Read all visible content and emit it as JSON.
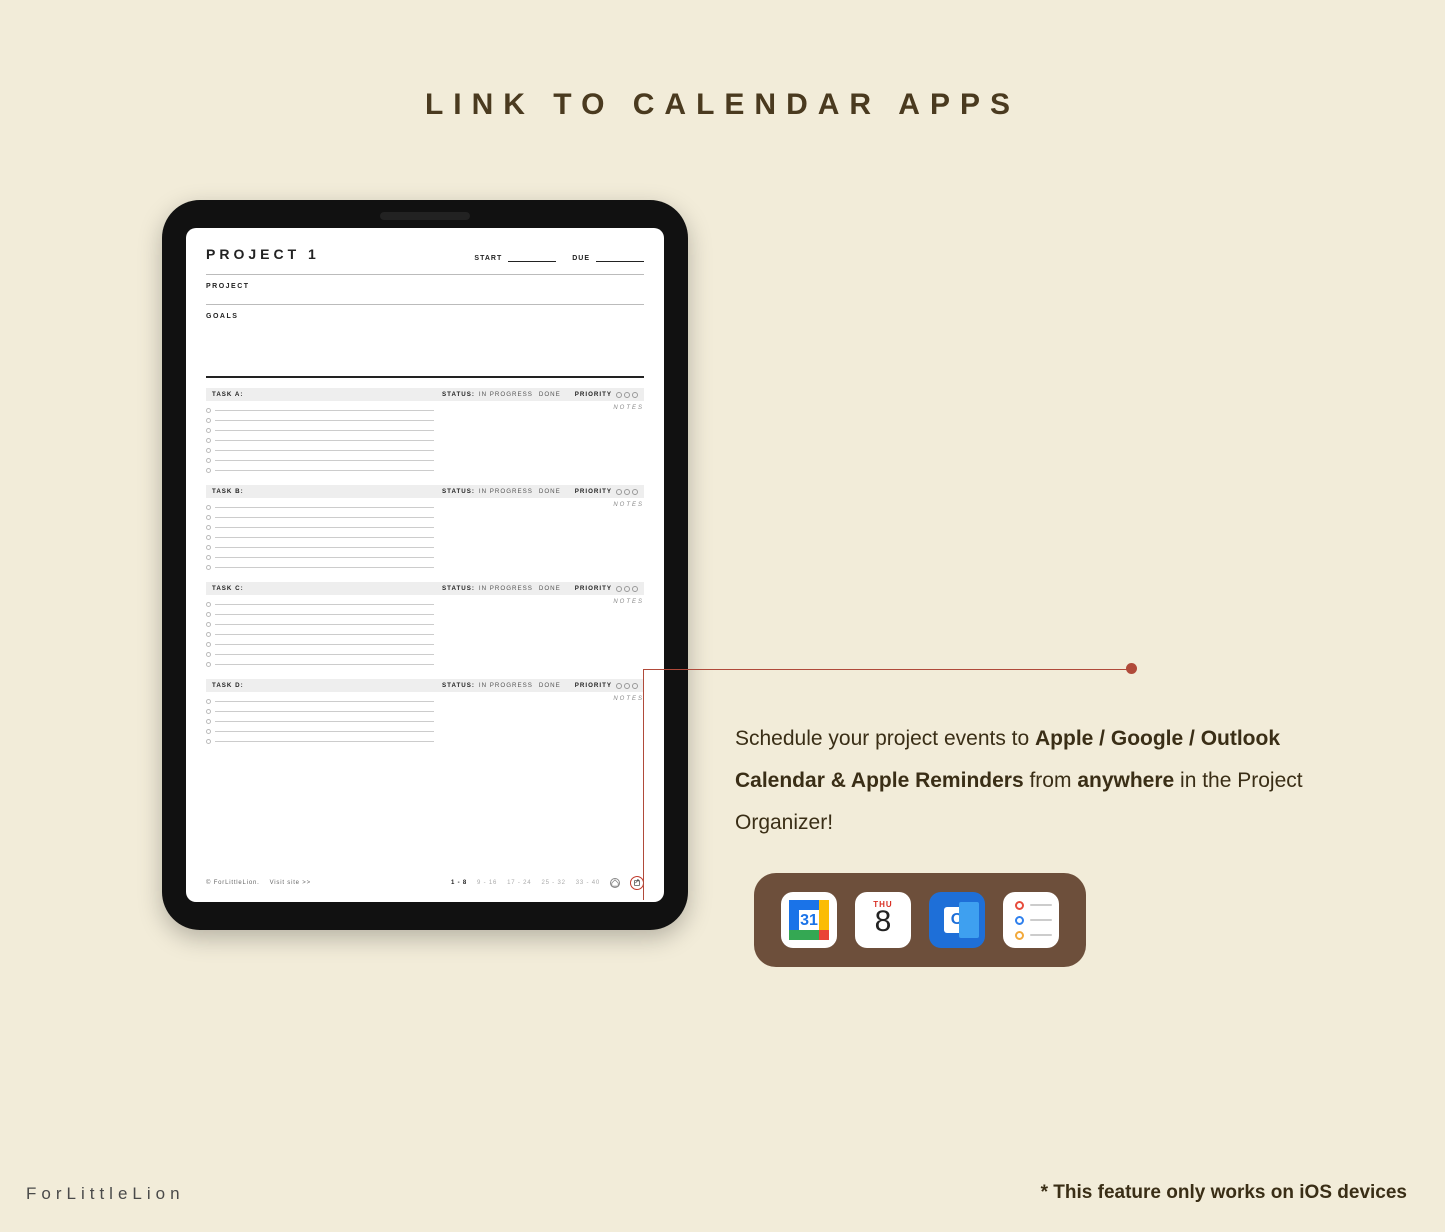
{
  "title": "LINK TO CALENDAR APPS",
  "planner": {
    "title": "PROJECT 1",
    "start_label": "START",
    "due_label": "DUE",
    "project_label": "PROJECT",
    "goals_label": "GOALS",
    "status_label": "STATUS:",
    "status_in_progress": "IN PROGRESS",
    "status_done": "DONE",
    "priority_label": "PRIORITY",
    "notes_label": "NOTES",
    "tasks": [
      {
        "name": "TASK A:"
      },
      {
        "name": "TASK B:"
      },
      {
        "name": "TASK C:"
      },
      {
        "name": "TASK D:"
      }
    ],
    "footer": {
      "copyright": "© ForLittleLion.",
      "visit": "Visit site >>",
      "pages": [
        "1 - 8",
        "9 - 16",
        "17 - 24",
        "25 - 32",
        "33 - 40"
      ],
      "active_page_index": 0
    }
  },
  "callout": {
    "text_1": "Schedule your project events to ",
    "bold_1": "Apple / Google / Outlook Calendar & Apple Reminders",
    "text_2": " from ",
    "bold_2": "anywhere",
    "text_3": " in the Project Organizer!"
  },
  "apple_cal": {
    "dow": "THU",
    "day": "8"
  },
  "outlook_letter": "O",
  "gcal_number": "31",
  "reminder_colors": [
    "#e74c3c",
    "#2f80ed",
    "#f2a93b"
  ],
  "footer_brand": "ForLittleLion",
  "footer_note": "* This feature only works on iOS devices"
}
